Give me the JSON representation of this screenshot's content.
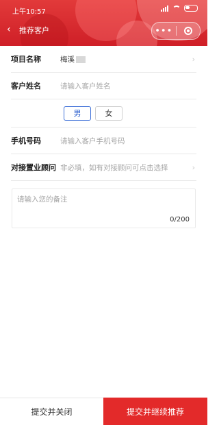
{
  "status_bar": {
    "time": "上午10:57"
  },
  "nav": {
    "title": "推荐客户",
    "back": "‹",
    "more": "•••"
  },
  "form": {
    "project": {
      "label": "项目名称",
      "value": "梅溪"
    },
    "customer": {
      "label": "客户姓名",
      "placeholder": "请输入客户姓名"
    },
    "gender": {
      "options": [
        "男",
        "女"
      ],
      "selected": "男"
    },
    "phone": {
      "label": "手机号码",
      "placeholder": "请输入客户手机号码"
    },
    "advisor": {
      "label": "对接置业顾问",
      "placeholder": "非必填，如有对接顾问可点击选择"
    },
    "note": {
      "placeholder": "请输入您的备注",
      "counter": "0/200"
    }
  },
  "actions": {
    "close": "提交并关闭",
    "next": "提交并继续推荐"
  },
  "colors": {
    "brand_red": "#e32a2a",
    "accent_blue": "#3d6fd8"
  }
}
